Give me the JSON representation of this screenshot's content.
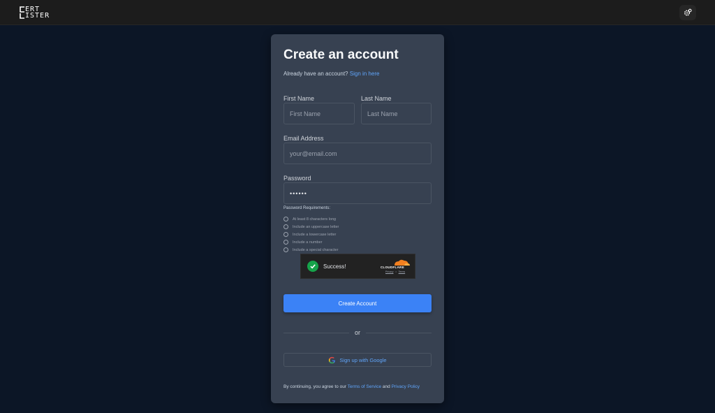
{
  "header": {
    "logo_line1": "ERT",
    "logo_line2": "ISTER",
    "settings_icon": "gear-icon"
  },
  "form": {
    "title": "Create an account",
    "signin_prompt": "Already have an account?",
    "signin_link": "Sign in here",
    "first_name_label": "First Name",
    "first_name_placeholder": "First Name",
    "last_name_label": "Last Name",
    "last_name_placeholder": "Last Name",
    "email_label": "Email Address",
    "email_placeholder": "your@email.com",
    "password_label": "Password",
    "password_value": "••••••",
    "requirements_title": "Password Requirements:",
    "requirements": [
      "At least 8 characters long",
      "Include an uppercase letter",
      "Include a lowercase letter",
      "Include a number",
      "Include a special character"
    ],
    "submit_label": "Create Account",
    "divider_text": "or",
    "google_label": "Sign up with Google",
    "terms_prefix": "By continuing, you agree to our",
    "terms_link": "Terms of Service",
    "terms_and": "and",
    "privacy_link": "Privacy Policy"
  },
  "captcha": {
    "status": "Success!",
    "brand": "CLOUDFLARE",
    "privacy": "Privacy",
    "separator": "•",
    "terms": "Terms"
  },
  "colors": {
    "background": "#0c1626",
    "card": "#374151",
    "accent": "#3b82f6",
    "link": "#60a5fa",
    "success": "#16a34a",
    "cloudflare": "#f38020"
  }
}
